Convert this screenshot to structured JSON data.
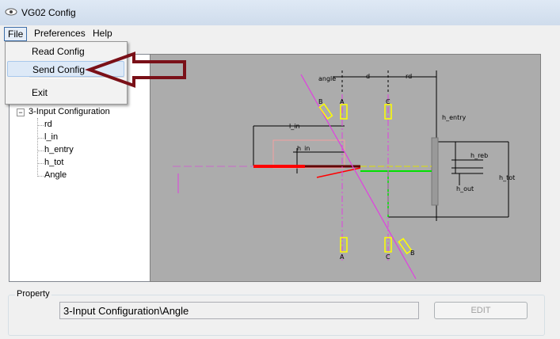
{
  "window": {
    "title": "VG02 Config",
    "icon": "eye-icon"
  },
  "menubar": {
    "file": "File",
    "preferences": "Preferences",
    "help": "Help"
  },
  "file_menu": {
    "items": [
      "Read Config",
      "Send Config",
      "Exit"
    ],
    "highlighted": "Send Config"
  },
  "tree": {
    "root": "3-Input Configuration",
    "children": [
      "rd",
      "l_in",
      "h_entry",
      "h_tot",
      "Angle"
    ]
  },
  "diagram": {
    "labels": {
      "angle": "angle",
      "d": "d",
      "rd": "rd",
      "l_in": "l_in",
      "h_in": "h_in",
      "h_entry": "h_entry",
      "h_reb": "h_reb",
      "h_out": "h_out",
      "h_tot": "h_tot",
      "A_top": "A",
      "C_top": "C",
      "B_top": "B",
      "A_bot": "A",
      "C_bot": "C",
      "B_bot": "B"
    }
  },
  "property": {
    "group_label": "Property",
    "value": "3-Input Configuration\\Angle",
    "edit_label": "EDIT",
    "edit_enabled": false
  },
  "colors": {
    "arrow": "#7a1018",
    "canvas_bg": "#acacac",
    "beam_red": "#ff0000",
    "beam_green": "#00e000",
    "beam_magenta": "#e040e0",
    "marker_yellow": "#ffff00"
  }
}
